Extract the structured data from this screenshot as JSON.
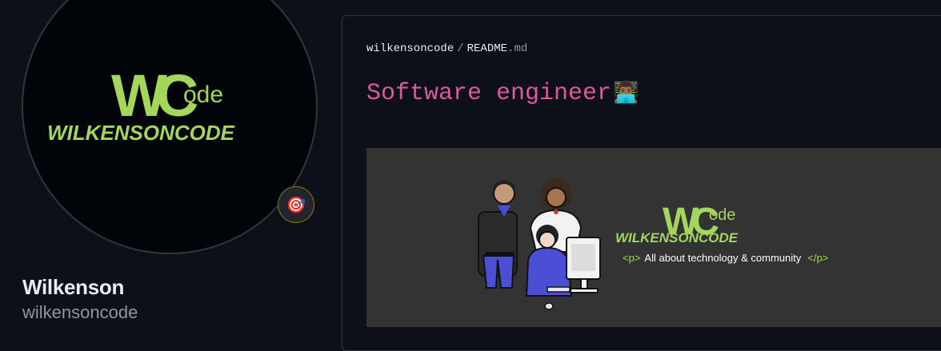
{
  "profile": {
    "name": "Wilkenson",
    "login": "wilkensoncode",
    "status_emoji": "🎯"
  },
  "logo": {
    "mark": "WC",
    "ode": "ode",
    "wordmark": "WILKENSONCODE",
    "accent": "#a3d65a"
  },
  "readme": {
    "owner": "wilkensoncode",
    "separator": "/",
    "file_name": "README",
    "file_ext": ".md",
    "heading": "Software engineer",
    "heading_emoji": "👨🏾‍💻"
  },
  "banner": {
    "tag_open": "<p>",
    "tagline": "All about technology  &  community",
    "tag_close": "</p>"
  }
}
